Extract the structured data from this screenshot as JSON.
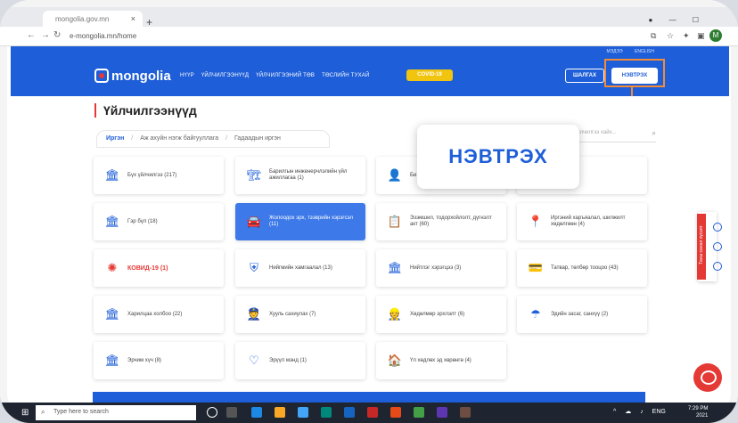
{
  "browser": {
    "tab_title": "mongolia.gov.mn",
    "tab_close": "×",
    "new_tab": "+",
    "url": "e-mongolia.mn/home",
    "profile_initial": "M"
  },
  "header": {
    "top_links": [
      "МЭДЭЭ",
      "ENGLISH"
    ],
    "logo_text": "mongolia",
    "nav": [
      "НҮҮР",
      "ҮЙЛЧИЛГЭЭНҮҮД",
      "ҮЙЛЧИЛГЭЭНИЙ ТӨВ",
      "ТӨСЛИЙН ТУХАЙ"
    ],
    "covid_label": "COVID-19",
    "search_button": "ШАЛГАХ",
    "login_button": "НЭВТРЭХ"
  },
  "main": {
    "page_title": "Үйлчилгээнүүд",
    "breadcrumb": [
      "Иргэн",
      "Аж ахуйн нэгж байгууллага",
      "Гадаадын иргэн"
    ],
    "search_placeholder": "Үйлчилгээ хайх...",
    "popup_label": "НЭВТРЭХ",
    "cards": [
      {
        "label": "Бүх үйлчилгээ (217)",
        "icon": "building-icon",
        "state": "normal"
      },
      {
        "label": "Барилгын инженерчлэлийн үйл ажиллагаа (1)",
        "icon": "construction-icon",
        "state": "normal"
      },
      {
        "label": "Би",
        "icon": "person-icon",
        "state": "normal"
      },
      {
        "label": "(6)",
        "icon": "document-icon",
        "state": "normal"
      },
      {
        "label": "Гэр бүл (18)",
        "icon": "family-icon",
        "state": "normal"
      },
      {
        "label": "Жолоодох эрх, тээврийн хэрэгсэл (11)",
        "icon": "car-icon",
        "state": "active"
      },
      {
        "label": "Эзэмшил, тодорхойлолт, дүгнэлт акт (60)",
        "icon": "certificate-icon",
        "state": "normal"
      },
      {
        "label": "Иргэний харъяалал, шилжилт хөдөлгөөн (4)",
        "icon": "location-icon",
        "state": "normal"
      },
      {
        "label": "КОВИД-19 (1)",
        "icon": "virus-icon",
        "state": "red"
      },
      {
        "label": "Нийгмийн хамгаалал (13)",
        "icon": "shield-icon",
        "state": "normal"
      },
      {
        "label": "Нийтлэг хэрэгцээ (3)",
        "icon": "bank-icon",
        "state": "normal"
      },
      {
        "label": "Татвар, төлбөр тооцоо (43)",
        "icon": "card-icon",
        "state": "normal"
      },
      {
        "label": "Харилцаа холбоо (22)",
        "icon": "tower-icon",
        "state": "normal"
      },
      {
        "label": "Хууль сахиулах (7)",
        "icon": "police-icon",
        "state": "normal"
      },
      {
        "label": "Хөдөлмөр эрхлэлт (6)",
        "icon": "worker-icon",
        "state": "normal"
      },
      {
        "label": "Эдийн засаг, санхүү (2)",
        "icon": "umbrella-icon",
        "state": "normal"
      },
      {
        "label": "Эрчим хүч (8)",
        "icon": "energy-icon",
        "state": "normal"
      },
      {
        "label": "Эрүүл мэнд (1)",
        "icon": "heart-icon",
        "state": "normal"
      },
      {
        "label": "Үл хөдлөх эд хөрөнгө (4)",
        "icon": "house-icon",
        "state": "normal"
      }
    ],
    "side_tab": "Таны санал хүсэлт"
  },
  "taskbar": {
    "search_placeholder": "Type here to search",
    "language": "ENG",
    "time": "7:29 PM",
    "date": "2021"
  },
  "colors": {
    "brand_blue": "#1e5ed8",
    "accent_orange": "#f28c38",
    "accent_red": "#e53935",
    "covid_yellow": "#f1c40f"
  }
}
